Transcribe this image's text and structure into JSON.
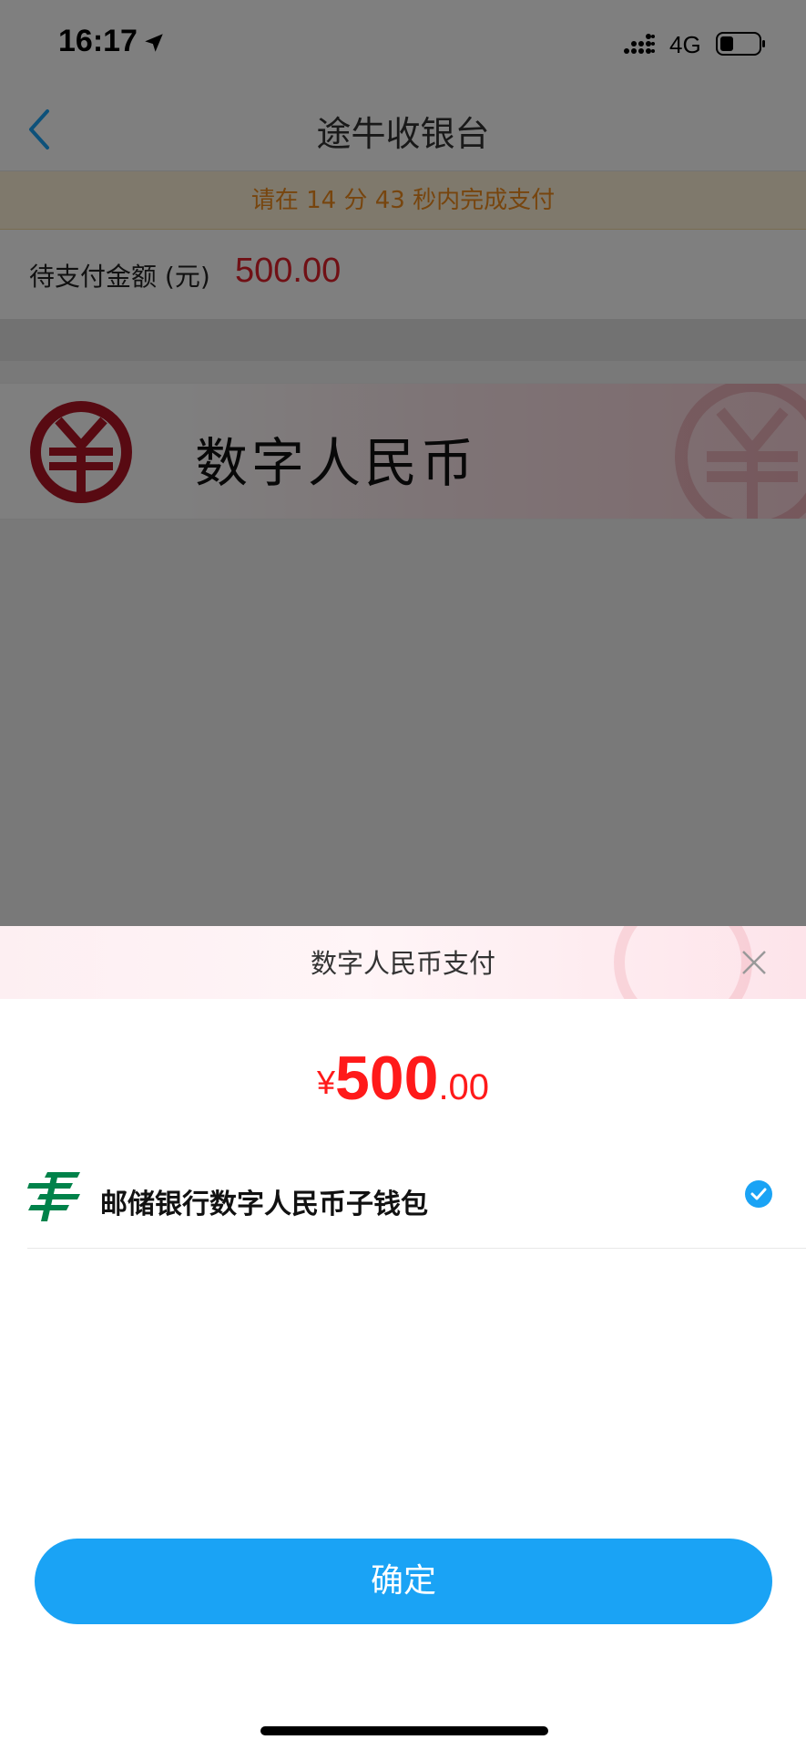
{
  "status_bar": {
    "time": "16:17",
    "network": "4G",
    "icons": [
      "location-arrow-icon",
      "signal-bars-icon",
      "battery-icon"
    ]
  },
  "nav": {
    "title": "途牛收银台",
    "back_icon": "chevron-left-icon"
  },
  "countdown_banner": {
    "text": "请在 14 分 43 秒内完成支付"
  },
  "order": {
    "amount_label": "待支付金额 (元)",
    "amount_value": "500.00"
  },
  "payment_method": {
    "label": "数字人民币",
    "icon": "digital-rmb-logo-icon"
  },
  "sheet": {
    "title": "数字人民币支付",
    "close_icon": "close-icon",
    "amount": {
      "currency": "¥",
      "integer": "500",
      "decimal": ".00"
    },
    "wallet": {
      "label": "邮储银行数字人民币子钱包",
      "icon": "postal-savings-bank-icon",
      "selected": true
    },
    "confirm_label": "确定"
  },
  "colors": {
    "accent_blue": "#1aa3f5",
    "price_red": "#ff1a1a",
    "banner_orange": "#ef8a1c",
    "rmb_red": "#b01425",
    "bank_green": "#00824a"
  }
}
